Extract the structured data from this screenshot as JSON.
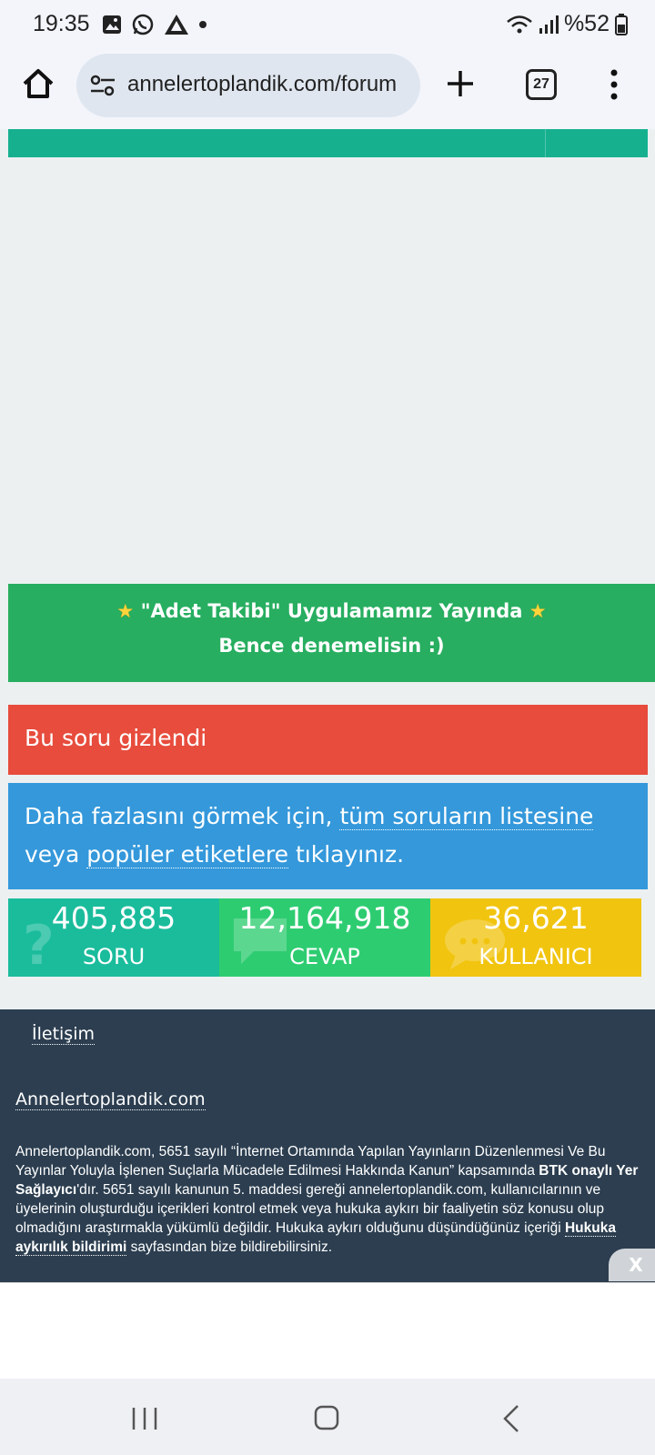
{
  "status_bar": {
    "time": "19:35",
    "battery": "%52",
    "icons": [
      "gallery-icon",
      "whatsapp-icon",
      "drive-icon",
      "dot-icon",
      "wifi-icon",
      "signal-icon",
      "battery-icon"
    ]
  },
  "browser": {
    "url": "annelertoplandik.com/forum",
    "tab_count": "27"
  },
  "promo": {
    "line1": "\"Adet Takibi\" Uygulamamız Yayında",
    "line2": "Bence denemelisin :)",
    "star": "★"
  },
  "notice": {
    "hidden_text": "Bu soru gizlendi",
    "info_prefix": "Daha fazlasını görmek için,",
    "info_link1": "tüm soruların listesine",
    "info_mid": "veya",
    "info_link2": "popüler etiketlere",
    "info_suffix": "tıklayınız."
  },
  "stats": [
    {
      "value": "405,885",
      "label": "SORU",
      "icon": "question-icon",
      "color": "#1abc9c"
    },
    {
      "value": "12,164,918",
      "label": "CEVAP",
      "icon": "comment-icon",
      "color": "#2ecc71"
    },
    {
      "value": "36,621",
      "label": "KULLANICI",
      "icon": "chat-bubble-icon",
      "color": "#f1c40f"
    }
  ],
  "footer": {
    "contact": "İletişim",
    "site": "Annelertoplandik.com",
    "legal_1": "Annelertoplandik.com, 5651 sayılı “İnternet Ortamında Yapılan Yayınların Düzenlenmesi Ve Bu Yayınlar Yoluyla İşlenen Suçlarla Mücadele Edilmesi Hakkında Kanun” kapsamında",
    "legal_bold": "BTK onaylı Yer Sağlayıcı",
    "legal_2": "'dır. 5651 sayılı kanunun 5. maddesi gereği annelertoplandik.com, kullanıcılarının ve üyelerinin oluşturduğu içerikleri kontrol etmek veya hukuka aykırı bir faaliyetin söz konusu olup olmadığını araştırmakla yükümlü değildir. Hukuka aykırı olduğunu düşündüğünüz içeriği",
    "legal_link": "Hukuka aykırılık bildirimi",
    "legal_3": "sayfasından bize bildirebilirsiniz.",
    "close_label": "X"
  }
}
